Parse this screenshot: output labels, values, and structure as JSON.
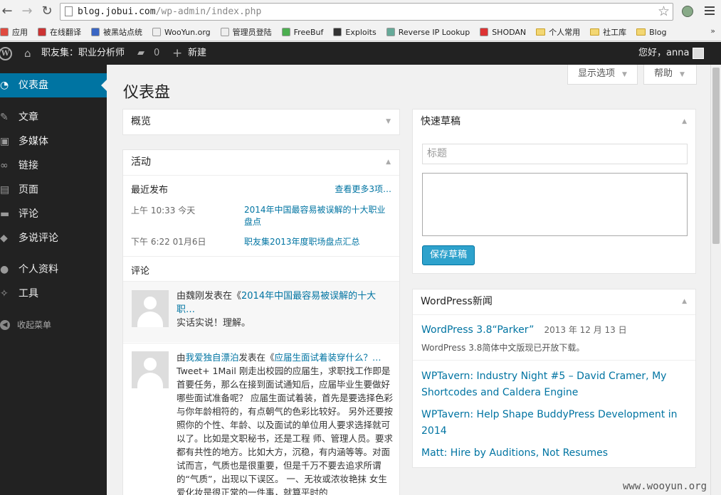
{
  "browser": {
    "url_domain": "blog.jobui.com",
    "url_path": "/wp-admin/index.php",
    "bookmarks": [
      {
        "label": "应用",
        "color": "#e04a3f"
      },
      {
        "label": "在线翻译",
        "color": "#c33"
      },
      {
        "label": "被黑站点统",
        "color": "#3a66c4"
      },
      {
        "label": "WooYun.org",
        "color": "#eee"
      },
      {
        "label": "管理员登陆",
        "color": "#eee"
      },
      {
        "label": "FreeBuf",
        "color": "#4caf50"
      },
      {
        "label": "Exploits",
        "color": "#333"
      },
      {
        "label": "Reverse IP Lookup",
        "color": "#6a9"
      },
      {
        "label": "SHODAN",
        "color": "#d33"
      },
      {
        "label": "个人常用",
        "color": "#f3d773"
      },
      {
        "label": "社工库",
        "color": "#f3d773"
      },
      {
        "label": "Blog",
        "color": "#f3d773"
      }
    ],
    "more": "»"
  },
  "adminbar": {
    "site_name": "职友集：职业分析师",
    "comments_count": "0",
    "new_label": "新建",
    "greeting": "您好，anna"
  },
  "sidebar": {
    "items": [
      {
        "label": "仪表盘",
        "icon": "dashboard-icon"
      },
      {
        "label": "文章",
        "icon": "pin-icon"
      },
      {
        "label": "多媒体",
        "icon": "media-icon"
      },
      {
        "label": "链接",
        "icon": "link-icon"
      },
      {
        "label": "页面",
        "icon": "page-icon"
      },
      {
        "label": "评论",
        "icon": "comment-icon"
      },
      {
        "label": "多说评论",
        "icon": "duoshuo-icon"
      },
      {
        "label": "个人资料",
        "icon": "user-icon"
      },
      {
        "label": "工具",
        "icon": "wrench-icon"
      }
    ],
    "collapse": "收起菜单"
  },
  "screen_options": "显示选项",
  "help": "帮助",
  "page_title": "仪表盘",
  "overview": {
    "title": "概览"
  },
  "activity": {
    "title": "活动",
    "recent_heading": "最近发布",
    "more_link": "查看更多3项…",
    "posts": [
      {
        "time": "上午 10:33 今天",
        "title": "2014年中国最容易被误解的十大职业盘点"
      },
      {
        "time": "下午 6:22 01月6日",
        "title": "职友集2013年度职场盘点汇总"
      }
    ],
    "comments_heading": "评论",
    "comments": [
      {
        "prefix": "由魏刚发表在《",
        "link": "2014年中国最容易被误解的十大职…",
        "body": "实话实说！理解。"
      },
      {
        "prefix": "由",
        "author": "我爱独自漂泊",
        "mid": "发表在《",
        "link": "应届生面试着装穿什么？…",
        "body": "Tweet+ 1Mail 刚走出校园的应届生，求职找工作即是首要任务，那么在接到面试通知后，应届毕业生要做好哪些面试准备呢？ 应届生面试着装，首先是要选择色彩与你年龄相符的，有点朝气的色彩比较好。 另外还要按照你的个性、年龄、以及面试的单位用人要求选择就可以了。比如是文职秘书，还是工程 师、管理人员。要求都有共性的地方。比如大方，沉稳，有内涵等等。对面试而言，气质也是很重要，但是千万不要去追求所谓的“气质”，出现以下误区。 一、无妆或浓妆艳抹 女生爱化妆是很正常的一件事，就算平时的"
      }
    ]
  },
  "quick_draft": {
    "title": "快速草稿",
    "title_placeholder": "标题",
    "save_label": "保存草稿"
  },
  "news": {
    "title": "WordPress新闻",
    "main_link": "WordPress 3.8“Parker”",
    "main_date": "2013 年 12 月 13 日",
    "main_desc": "WordPress 3.8简体中文版现已开放下载。",
    "links": [
      "WPTavern: Industry Night #5 – David Cramer, My Shortcodes and Caldera Engine",
      "WPTavern: Help Shape BuddyPress Development in 2014",
      "Matt: Hire by Auditions, Not Resumes"
    ]
  },
  "watermark": "www.wooyun.org"
}
